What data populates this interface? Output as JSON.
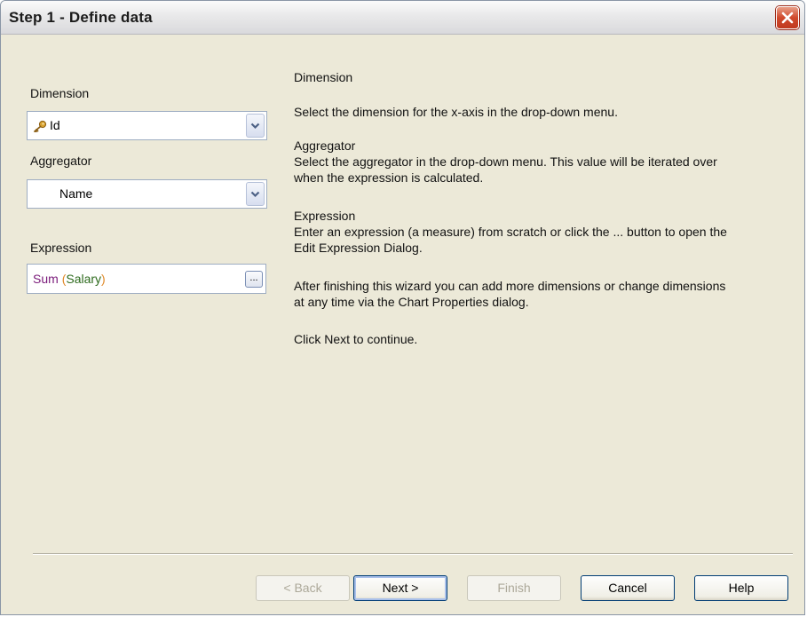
{
  "window": {
    "title": "Step 1 - Define data"
  },
  "form": {
    "dimension_label": "Dimension",
    "dimension_value": "Id",
    "aggregator_label": "Aggregator",
    "aggregator_value": "Name",
    "expression_label": "Expression",
    "expression": {
      "func": "Sum",
      "open": "(",
      "field": "Salary",
      "close": ")"
    },
    "expression_button": "..."
  },
  "help": {
    "dimension_heading": "Dimension",
    "dimension_text": "Select the dimension for the x-axis in the drop-down menu.",
    "aggregator_heading": "Aggregator",
    "aggregator_text_1": "Select the aggregator in the drop-down menu. This value will be iterated over",
    "aggregator_text_2": "when the expression is calculated.",
    "expression_heading": "Expression",
    "expression_text_1": "Enter an expression (a measure) from scratch or click the ... button to open the",
    "expression_text_2": "Edit Expression Dialog.",
    "after_text_1": "After finishing this wizard you can add more dimensions or change dimensions",
    "after_text_2": "at any time via the Chart Properties dialog.",
    "next_text": "Click Next to continue."
  },
  "buttons": {
    "back": "< Back",
    "next": "Next >",
    "finish": "Finish",
    "cancel": "Cancel",
    "help": "Help"
  },
  "colors": {
    "expression_function": "#7a1a7a",
    "expression_paren": "#e08a2a",
    "expression_field": "#2e6b1e",
    "dialog_background": "#ece9d8"
  },
  "icons": {
    "dimension_key": "key-icon",
    "dropdown": "chevron-down-icon",
    "close": "close-icon"
  }
}
